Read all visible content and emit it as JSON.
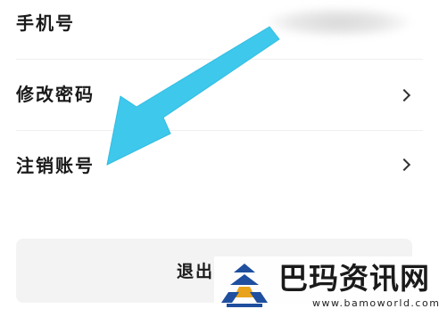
{
  "settings": {
    "rows": [
      {
        "label": "手机号"
      },
      {
        "label": "修改密码"
      },
      {
        "label": "注销账号"
      }
    ]
  },
  "logout": {
    "label": "退出"
  },
  "annotation": {
    "arrow_color": "#3dc8ec"
  },
  "watermark": {
    "title": "巴玛资讯网",
    "url": "www.bamoworld.com",
    "logo_colors": [
      "#1f4f9e",
      "#e8a21c"
    ]
  }
}
